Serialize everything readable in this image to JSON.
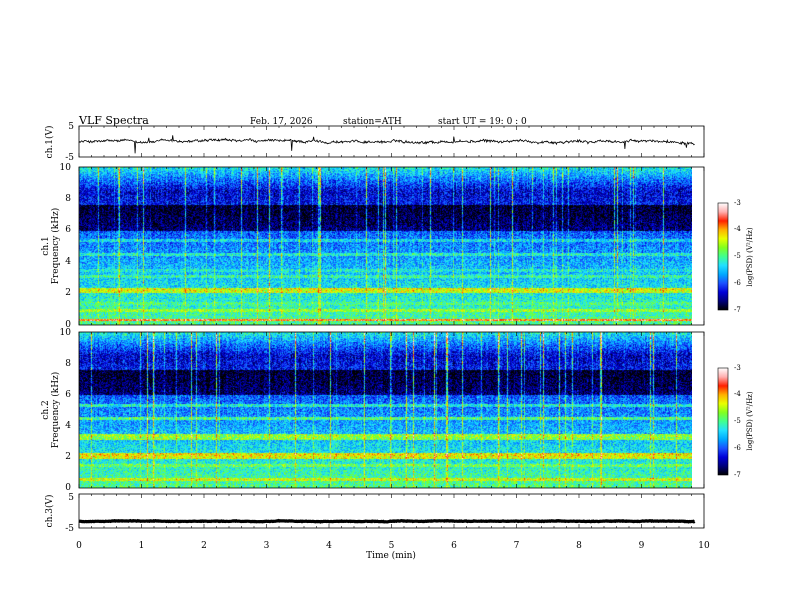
{
  "header": {
    "title": "VLF  Spectra",
    "date": "Feb. 17, 2026",
    "station": "station=ATH",
    "start": "start  UT  =    19: 0   : 0"
  },
  "colors": {
    "background": "#ffffff",
    "axes": "#000000",
    "waveform": "#000000",
    "colormap": [
      "#000000",
      "#00007a",
      "#0000d8",
      "#1a50ff",
      "#00a8ff",
      "#22e0ff",
      "#40ff90",
      "#80ff20",
      "#e8ff00",
      "#ffb000",
      "#ff2000",
      "#ffb0b0",
      "#ffffff"
    ]
  },
  "chart_data": [
    {
      "type": "line",
      "id": "ch1-waveform",
      "ylabel": "ch.1(V)",
      "ylim": [
        -5,
        5
      ],
      "yticks": [
        "5",
        "-5"
      ],
      "xlim": [
        0,
        10
      ],
      "baseline": 0,
      "noise_amplitude": 0.6,
      "spikes": [
        {
          "x": 0.9,
          "y": -3.8
        },
        {
          "x": 1.12,
          "y": 1.2
        },
        {
          "x": 1.5,
          "y": 2.0
        },
        {
          "x": 3.4,
          "y": -3.0
        },
        {
          "x": 3.75,
          "y": 1.5
        },
        {
          "x": 6.0,
          "y": 1.6
        },
        {
          "x": 8.73,
          "y": -2.4
        },
        {
          "x": 9.72,
          "y": -2.0
        }
      ]
    },
    {
      "type": "heatmap",
      "id": "ch1-spectrogram",
      "ylabel_line1": "ch.1",
      "ylabel_line2": "Frequency (kHz)",
      "ylim": [
        0,
        10
      ],
      "yticks": [
        "0",
        "2",
        "4",
        "6",
        "8",
        "10"
      ],
      "xlim": [
        0,
        9.85
      ],
      "colorbar_label": "log(PSD) (V²/Hz)",
      "colorbar_range": [
        -7,
        -3
      ],
      "colorbar_ticks": [
        "-3",
        "-4",
        "-5",
        "-6",
        "-7"
      ],
      "bands": [
        {
          "f": 0.35,
          "level": -3.5
        },
        {
          "f": 0.95,
          "level": -4.6
        },
        {
          "f": 1.4,
          "level": -5.0
        },
        {
          "f": 2.15,
          "level": -4.3
        },
        {
          "f": 2.3,
          "level": -4.2
        },
        {
          "f": 3.1,
          "level": -5.1
        },
        {
          "f": 3.5,
          "level": -5.3
        },
        {
          "f": 4.5,
          "level": -5.2
        },
        {
          "f": 5.4,
          "level": -5.4
        }
      ],
      "sferic_strength": 1.0
    },
    {
      "type": "heatmap",
      "id": "ch2-spectrogram",
      "ylabel_line1": "ch.2",
      "ylabel_line2": "Frequency (kHz)",
      "ylim": [
        0,
        10
      ],
      "yticks": [
        "0",
        "2",
        "4",
        "6",
        "8",
        "10"
      ],
      "xlim": [
        0,
        9.85
      ],
      "colorbar_label": "log(PSD) (V²/Hz)",
      "colorbar_range": [
        -7,
        -3
      ],
      "colorbar_ticks": [
        "-3",
        "-4",
        "-5",
        "-6",
        "-7"
      ],
      "bands": [
        {
          "f": 0.6,
          "level": -4.3
        },
        {
          "f": 1.5,
          "level": -4.8
        },
        {
          "f": 2.0,
          "level": -4.2
        },
        {
          "f": 2.2,
          "level": -4.1
        },
        {
          "f": 3.2,
          "level": -4.6
        },
        {
          "f": 3.4,
          "level": -4.5
        },
        {
          "f": 4.5,
          "level": -4.9
        },
        {
          "f": 5.3,
          "level": -5.2
        }
      ],
      "sferic_strength": 1.2
    },
    {
      "type": "line",
      "id": "ch3-waveform",
      "ylabel": "ch.3(V)",
      "ylim": [
        -5,
        5
      ],
      "yticks": [
        "5",
        "-5"
      ],
      "xlim": [
        0,
        10
      ],
      "baseline": -3,
      "noise_amplitude": 0.12,
      "spikes": []
    },
    {
      "type": "axis",
      "id": "time-axis",
      "xlabel": "Time  (min)",
      "xlim": [
        0,
        10
      ],
      "xticks": [
        "0",
        "1",
        "2",
        "3",
        "4",
        "5",
        "6",
        "7",
        "8",
        "9",
        "10"
      ]
    }
  ]
}
